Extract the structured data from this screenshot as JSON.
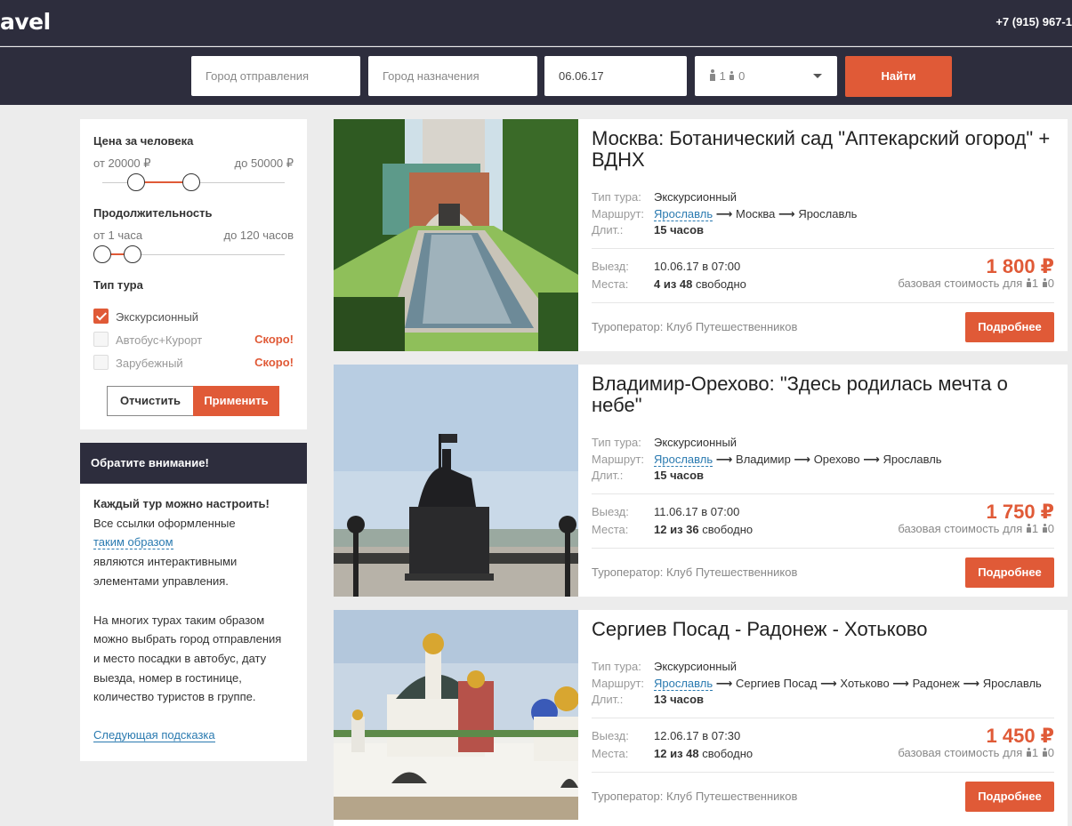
{
  "header": {
    "logo": "avel",
    "phone": "+7 (915) 967-1"
  },
  "search": {
    "from_placeholder": "Город отправления",
    "to_placeholder": "Город назначения",
    "date": "06.06.17",
    "adults": "1",
    "children": "0",
    "find_label": "Найти"
  },
  "filters": {
    "price_title": "Цена за человека",
    "price_from": "от 20000 ₽",
    "price_to": "до 50000 ₽",
    "duration_title": "Продолжительность",
    "duration_from": "от 1 часа",
    "duration_to": "до 120 часов",
    "type_title": "Тип тура",
    "types": [
      {
        "label": "Экскурсионный",
        "checked": true,
        "note": ""
      },
      {
        "label": "Автобус+Курорт",
        "checked": false,
        "note": "Скоро!"
      },
      {
        "label": "Зарубежный",
        "checked": false,
        "note": "Скоро!"
      }
    ],
    "clear_label": "Отчистить",
    "apply_label": "Применить"
  },
  "notice": {
    "title": "Обратите внимание!",
    "bold_line": "Каждый тур можно настроить!",
    "line1": "Все ссылки оформленные",
    "link_text": "таким образом",
    "line2": "являются интерактивными",
    "line3": "элементами управления.",
    "para2_1": "На многих турах таким образом",
    "para2_2": "можно выбрать город отправления",
    "para2_3": "и место посадки в автобус, дату",
    "para2_4": "выезда, номер в гостинице,",
    "para2_5": "количество туристов в группе.",
    "next_tip": "Следующая подсказка"
  },
  "labels": {
    "type": "Тип тура:",
    "route": "Маршрут:",
    "duration": "Длит.:",
    "departure": "Выезд:",
    "seats": "Места:",
    "base_cost": "базовая стоимость для",
    "free": "свободно",
    "more": "Подробнее"
  },
  "tours": [
    {
      "title": "Москва: Ботанический сад \"Аптекарский огород\" + ВДНХ",
      "type": "Экскурсионный",
      "route_start": "Ярославль",
      "route_rest": [
        "Москва",
        "Ярославль"
      ],
      "duration": "15 часов",
      "departure": "10.06.17 в 07:00",
      "seats": "4 из 48",
      "price": "1 800 ₽",
      "adults": "1",
      "children": "0",
      "operator": "Туроператор: Клуб Путешественников"
    },
    {
      "title": "Владимир-Орехово: \"Здесь родилась мечта о небе\"",
      "type": "Экскурсионный",
      "route_start": "Ярославль",
      "route_rest": [
        "Владимир",
        "Орехово",
        "Ярославль"
      ],
      "duration": "15 часов",
      "departure": "11.06.17 в 07:00",
      "seats": "12 из 36",
      "price": "1 750 ₽",
      "adults": "1",
      "children": "0",
      "operator": "Туроператор: Клуб Путешественников"
    },
    {
      "title": "Сергиев Посад - Радонеж - Хотьково",
      "type": "Экскурсионный",
      "route_start": "Ярославль",
      "route_rest": [
        "Сергиев Посад",
        "Хотьково",
        "Радонеж",
        "Ярославль"
      ],
      "duration": "13 часов",
      "departure": "12.06.17 в 07:30",
      "seats": "12 из 48",
      "price": "1 450 ₽",
      "adults": "1",
      "children": "0",
      "operator": "Туроператор: Клуб Путешественников"
    }
  ]
}
